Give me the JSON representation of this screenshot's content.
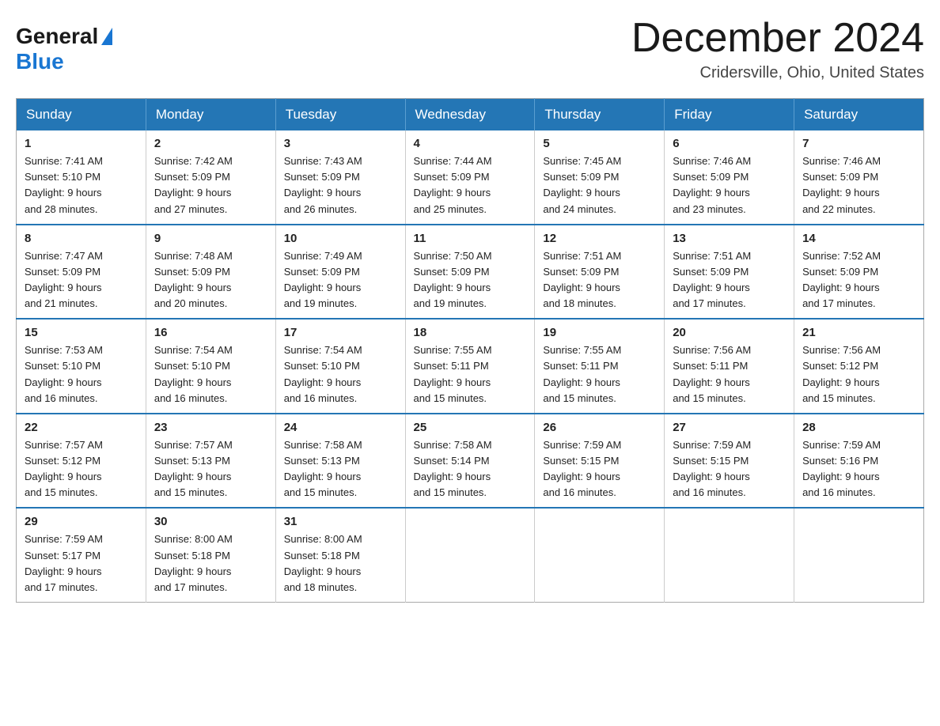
{
  "logo": {
    "general": "General",
    "blue": "Blue"
  },
  "title": "December 2024",
  "subtitle": "Cridersville, Ohio, United States",
  "weekdays": [
    "Sunday",
    "Monday",
    "Tuesday",
    "Wednesday",
    "Thursday",
    "Friday",
    "Saturday"
  ],
  "weeks": [
    [
      {
        "day": "1",
        "sunrise": "7:41 AM",
        "sunset": "5:10 PM",
        "daylight": "9 hours and 28 minutes."
      },
      {
        "day": "2",
        "sunrise": "7:42 AM",
        "sunset": "5:09 PM",
        "daylight": "9 hours and 27 minutes."
      },
      {
        "day": "3",
        "sunrise": "7:43 AM",
        "sunset": "5:09 PM",
        "daylight": "9 hours and 26 minutes."
      },
      {
        "day": "4",
        "sunrise": "7:44 AM",
        "sunset": "5:09 PM",
        "daylight": "9 hours and 25 minutes."
      },
      {
        "day": "5",
        "sunrise": "7:45 AM",
        "sunset": "5:09 PM",
        "daylight": "9 hours and 24 minutes."
      },
      {
        "day": "6",
        "sunrise": "7:46 AM",
        "sunset": "5:09 PM",
        "daylight": "9 hours and 23 minutes."
      },
      {
        "day": "7",
        "sunrise": "7:46 AM",
        "sunset": "5:09 PM",
        "daylight": "9 hours and 22 minutes."
      }
    ],
    [
      {
        "day": "8",
        "sunrise": "7:47 AM",
        "sunset": "5:09 PM",
        "daylight": "9 hours and 21 minutes."
      },
      {
        "day": "9",
        "sunrise": "7:48 AM",
        "sunset": "5:09 PM",
        "daylight": "9 hours and 20 minutes."
      },
      {
        "day": "10",
        "sunrise": "7:49 AM",
        "sunset": "5:09 PM",
        "daylight": "9 hours and 19 minutes."
      },
      {
        "day": "11",
        "sunrise": "7:50 AM",
        "sunset": "5:09 PM",
        "daylight": "9 hours and 19 minutes."
      },
      {
        "day": "12",
        "sunrise": "7:51 AM",
        "sunset": "5:09 PM",
        "daylight": "9 hours and 18 minutes."
      },
      {
        "day": "13",
        "sunrise": "7:51 AM",
        "sunset": "5:09 PM",
        "daylight": "9 hours and 17 minutes."
      },
      {
        "day": "14",
        "sunrise": "7:52 AM",
        "sunset": "5:09 PM",
        "daylight": "9 hours and 17 minutes."
      }
    ],
    [
      {
        "day": "15",
        "sunrise": "7:53 AM",
        "sunset": "5:10 PM",
        "daylight": "9 hours and 16 minutes."
      },
      {
        "day": "16",
        "sunrise": "7:54 AM",
        "sunset": "5:10 PM",
        "daylight": "9 hours and 16 minutes."
      },
      {
        "day": "17",
        "sunrise": "7:54 AM",
        "sunset": "5:10 PM",
        "daylight": "9 hours and 16 minutes."
      },
      {
        "day": "18",
        "sunrise": "7:55 AM",
        "sunset": "5:11 PM",
        "daylight": "9 hours and 15 minutes."
      },
      {
        "day": "19",
        "sunrise": "7:55 AM",
        "sunset": "5:11 PM",
        "daylight": "9 hours and 15 minutes."
      },
      {
        "day": "20",
        "sunrise": "7:56 AM",
        "sunset": "5:11 PM",
        "daylight": "9 hours and 15 minutes."
      },
      {
        "day": "21",
        "sunrise": "7:56 AM",
        "sunset": "5:12 PM",
        "daylight": "9 hours and 15 minutes."
      }
    ],
    [
      {
        "day": "22",
        "sunrise": "7:57 AM",
        "sunset": "5:12 PM",
        "daylight": "9 hours and 15 minutes."
      },
      {
        "day": "23",
        "sunrise": "7:57 AM",
        "sunset": "5:13 PM",
        "daylight": "9 hours and 15 minutes."
      },
      {
        "day": "24",
        "sunrise": "7:58 AM",
        "sunset": "5:13 PM",
        "daylight": "9 hours and 15 minutes."
      },
      {
        "day": "25",
        "sunrise": "7:58 AM",
        "sunset": "5:14 PM",
        "daylight": "9 hours and 15 minutes."
      },
      {
        "day": "26",
        "sunrise": "7:59 AM",
        "sunset": "5:15 PM",
        "daylight": "9 hours and 16 minutes."
      },
      {
        "day": "27",
        "sunrise": "7:59 AM",
        "sunset": "5:15 PM",
        "daylight": "9 hours and 16 minutes."
      },
      {
        "day": "28",
        "sunrise": "7:59 AM",
        "sunset": "5:16 PM",
        "daylight": "9 hours and 16 minutes."
      }
    ],
    [
      {
        "day": "29",
        "sunrise": "7:59 AM",
        "sunset": "5:17 PM",
        "daylight": "9 hours and 17 minutes."
      },
      {
        "day": "30",
        "sunrise": "8:00 AM",
        "sunset": "5:18 PM",
        "daylight": "9 hours and 17 minutes."
      },
      {
        "day": "31",
        "sunrise": "8:00 AM",
        "sunset": "5:18 PM",
        "daylight": "9 hours and 18 minutes."
      },
      null,
      null,
      null,
      null
    ]
  ],
  "labels": {
    "sunrise": "Sunrise:",
    "sunset": "Sunset:",
    "daylight": "Daylight:"
  }
}
